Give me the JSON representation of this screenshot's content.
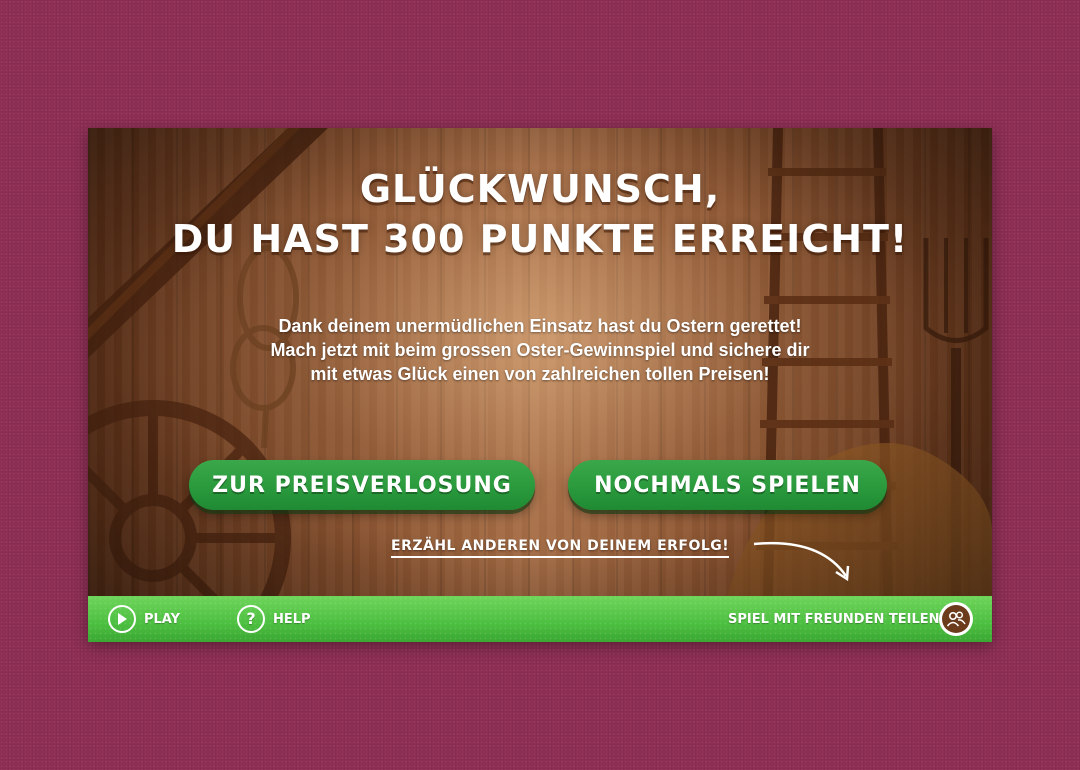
{
  "heading": {
    "line1": "GLÜCKWUNSCH,",
    "line2": "DU HAST 300 PUNKTE ERREICHT!"
  },
  "message": {
    "line1": "Dank deinem unermüdlichen Einsatz hast du Ostern gerettet!",
    "line2": "Mach jetzt mit beim grossen Oster-Gewinnspiel und sichere dir",
    "line3": "mit etwas Glück einen von zahlreichen tollen Preisen!"
  },
  "buttons": {
    "prize_draw": "ZUR PREISVERLOSUNG",
    "play_again": "NOCHMALS SPIELEN"
  },
  "share_link": "ERZÄHL ANDEREN VON DEINEM ERFOLG!",
  "footer": {
    "play": "PLAY",
    "help": "HELP",
    "share": "SPIEL MIT FREUNDEN TEILEN"
  },
  "icons": {
    "play": "play-icon",
    "help": "help-icon",
    "share": "friends-icon",
    "arrow": "curved-arrow-icon"
  },
  "colors": {
    "page_background": "#8f2f55",
    "button_green": "#2a9a3d",
    "footer_green": "#4cbf40",
    "wood": "#87502d"
  }
}
